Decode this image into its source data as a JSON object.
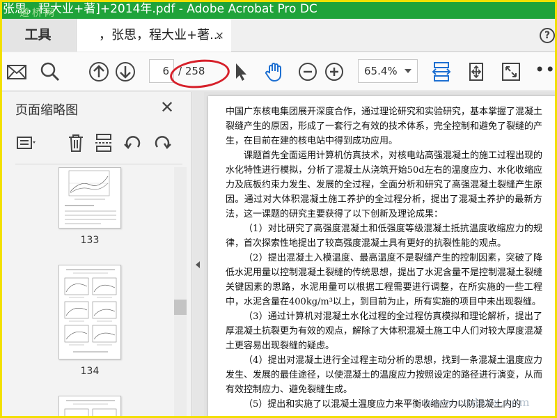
{
  "window": {
    "title": "张思，程大业+著]+2014年.pdf - Adobe Acrobat Pro DC",
    "title_prefix_watermark": "道桥网"
  },
  "tabs": {
    "tools_label": "工具",
    "doc_label": "，张思，程大业+著...",
    "doc_close": "×",
    "help_label": "?"
  },
  "toolbar": {
    "icons": [
      "mail-icon",
      "search-icon",
      "page-up-icon",
      "page-down-icon",
      "select-arrow-icon",
      "hand-tool-icon",
      "zoom-out-icon",
      "zoom-in-icon",
      "fit-width-icon",
      "fit-page-icon",
      "fullscreen-icon"
    ],
    "page_current": "6",
    "page_total": "/ 258",
    "zoom_value": "65.4%",
    "more_label": "•••"
  },
  "panel": {
    "title": "页面缩略图",
    "close_label": "✕",
    "thumbnails": [
      {
        "label": "133"
      },
      {
        "label": "134"
      }
    ]
  },
  "document": {
    "paragraphs": [
      {
        "text": "中国广东核电集团展开深度合作，通过理论研究和实验研究，基本掌握了混凝土裂缝产生的原因，形成了一套行之有效的技术体系，完全控制和避免了裂缝的产生，在目前在建的核电站中得到成功应用。",
        "indent": false
      },
      {
        "text": "课题首先全面运用计算机仿真技术，对核电站高强混凝土的施工过程出现的水化特性进行模拟，分析了混凝土从浇筑开始50d左右的温度应力、水化收缩应力及底板约束力发生、发展的全过程，全面分析和研究了高强混凝土裂缝产生原因。通过对大体积混凝土施工养护的全过程分析，提出了混凝土养护的最新方法，这一课题的研究主要获得了以下创新及理论成果：",
        "indent": true
      },
      {
        "text": "（1）对比研究了高强度混凝土和低强度等级混凝土抵抗温度收缩应力的规律，首次探索性地提出了较高强度混凝土具有更好的抗裂性能的观点。",
        "indent": true
      },
      {
        "text": "（2）提出混凝土入模温度、最高温度不是裂缝产生的控制因素，突破了降低水泥用量以控制混凝土裂缝的传统思想，提出了水泥含量不是控制混凝土裂缝关键因素的思路，水泥用量可以根据工程需要进行调整，在所实施的一些工程中，水泥含量在400kg/m³以上，到目前为止，所有实施的项目中未出现裂缝。",
        "indent": true
      },
      {
        "text": "（3）通过计算机对混凝土水化过程的全过程仿真模拟和理论解析，提出了厚混凝土抗裂更为有效的观点，解除了大体积混凝土施工中人们对较大厚度混凝土更容易出现裂缝的疑虑。",
        "indent": true
      },
      {
        "text": "（4）提出对混凝土进行全过程主动分析的思想，找到一条混凝土温度应力发生、发展的最佳途径，以使混凝土的温度应力按照设定的路径进行演变，从而有效控制应力、避免裂缝生成。",
        "indent": true
      },
      {
        "text": "（5）提出和实施了以混凝土温度应力来平衡收缩应力以防混凝土内的",
        "indent": true
      }
    ]
  },
  "watermark_bottom": "www.cadocx.com",
  "colors": {
    "titlebar": "#1fa33a",
    "accent": "#1d6fd1",
    "annotation": "#d6202a",
    "frame": "#f2e000"
  }
}
